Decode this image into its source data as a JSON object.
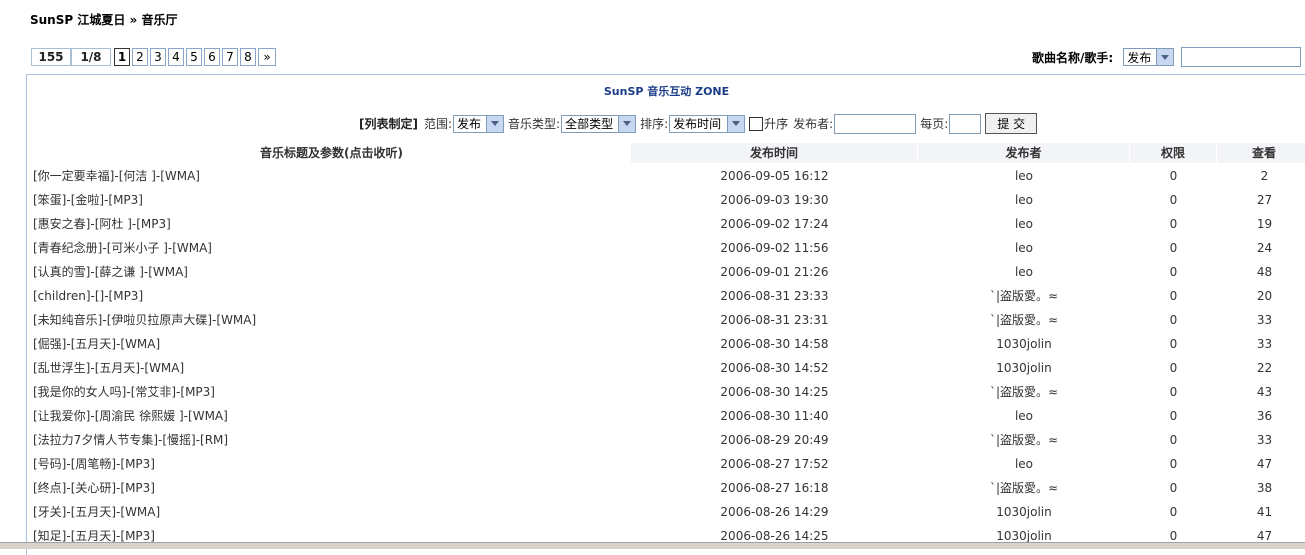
{
  "breadcrumb": {
    "site": "SunSP 江城夏日",
    "sep": " » ",
    "section": "音乐厅"
  },
  "pager": {
    "total": "155",
    "current": "1/8",
    "pages": [
      "1",
      "2",
      "3",
      "4",
      "5",
      "6",
      "7",
      "8"
    ],
    "active_page": "1",
    "next": "»"
  },
  "search": {
    "label": "歌曲名称/歌手:",
    "scope": "发布",
    "query": ""
  },
  "panel_title": "SunSP 音乐互动  ZONE",
  "filters": {
    "heading": "[列表制定]",
    "range_label": "范围:",
    "range_value": "发布",
    "type_label": "音乐类型:",
    "type_value": "全部类型",
    "sort_label": "排序:",
    "sort_value": "发布时间",
    "asc_label": "升序",
    "publisher_label": "发布者:",
    "publisher_value": "",
    "perpage_label": "每页:",
    "perpage_value": "",
    "submit_label": "提 交"
  },
  "table": {
    "headers": [
      "音乐标题及参数(点击收听)",
      "发布时间",
      "发布者",
      "权限",
      "查看"
    ],
    "rows": [
      [
        "[你一定要幸福]-[何洁 ]-[WMA]",
        "2006-09-05 16:12",
        "leo",
        "0",
        "2"
      ],
      [
        "[笨蛋]-[金啦]-[MP3]",
        "2006-09-03 19:30",
        "leo",
        "0",
        "27"
      ],
      [
        "[惠安之春]-[阿杜 ]-[MP3]",
        "2006-09-02 17:24",
        "leo",
        "0",
        "19"
      ],
      [
        "[青春纪念册]-[可米小子 ]-[WMA]",
        "2006-09-02 11:56",
        "leo",
        "0",
        "24"
      ],
      [
        "[认真的雪]-[薛之谦 ]-[WMA]",
        "2006-09-01 21:26",
        "leo",
        "0",
        "48"
      ],
      [
        "[children]-[]-[MP3]",
        "2006-08-31 23:33",
        "`|盗版愛。≈",
        "0",
        "20"
      ],
      [
        "[未知纯音乐]-[伊啦贝拉原声大碟]-[WMA]",
        "2006-08-31 23:31",
        "`|盗版愛。≈",
        "0",
        "33"
      ],
      [
        "[倔强]-[五月天]-[WMA]",
        "2006-08-30 14:58",
        "1030jolin",
        "0",
        "33"
      ],
      [
        "[乱世浮生]-[五月天]-[WMA]",
        "2006-08-30 14:52",
        "1030jolin",
        "0",
        "22"
      ],
      [
        "[我是你的女人吗]-[常艾非]-[MP3]",
        "2006-08-30 14:25",
        "`|盗版愛。≈",
        "0",
        "43"
      ],
      [
        "[让我爱你]-[周渝民 徐熙媛 ]-[WMA]",
        "2006-08-30 11:40",
        "leo",
        "0",
        "36"
      ],
      [
        "[法拉力7夕情人节专集]-[慢摇]-[RM]",
        "2006-08-29 20:49",
        "`|盗版愛。≈",
        "0",
        "33"
      ],
      [
        "[号码]-[周笔畅]-[MP3]",
        "2006-08-27 17:52",
        "leo",
        "0",
        "47"
      ],
      [
        "[终点]-[关心研]-[MP3]",
        "2006-08-27 16:18",
        "`|盗版愛。≈",
        "0",
        "38"
      ],
      [
        "[牙关]-[五月天]-[WMA]",
        "2006-08-26 14:29",
        "1030jolin",
        "0",
        "41"
      ],
      [
        "[知足]-[五月天]-[MP3]",
        "2006-08-26 14:25",
        "1030jolin",
        "0",
        "47"
      ]
    ]
  }
}
